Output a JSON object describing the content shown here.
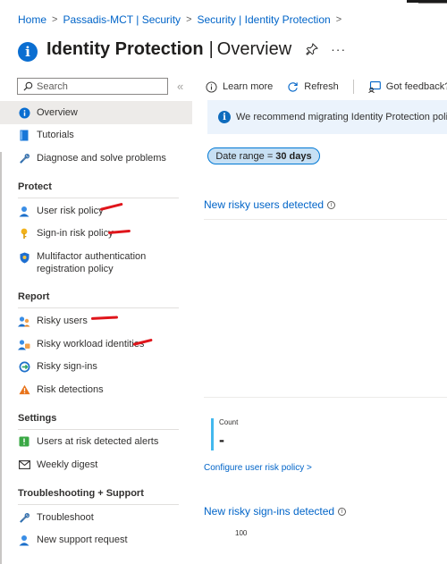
{
  "breadcrumb": [
    "Home",
    "Passadis-MCT | Security",
    "Security | Identity Protection"
  ],
  "header": {
    "title": "Identity Protection",
    "separator": "|",
    "subtitle": "Overview"
  },
  "sidebar": {
    "search_placeholder": "Search",
    "items": [
      {
        "label": "Overview",
        "icon": "info-icon",
        "active": true
      },
      {
        "label": "Tutorials",
        "icon": "book-icon"
      },
      {
        "label": "Diagnose and solve problems",
        "icon": "wrench-icon"
      }
    ],
    "sections": [
      {
        "title": "Protect",
        "items": [
          {
            "label": "User risk policy",
            "icon": "user-icon"
          },
          {
            "label": "Sign-in risk policy",
            "icon": "key-icon"
          },
          {
            "label_lines": [
              "Multifactor authentication",
              "registration policy"
            ],
            "icon": "shield-icon"
          }
        ]
      },
      {
        "title": "Report",
        "items": [
          {
            "label": "Risky users",
            "icon": "users-icon"
          },
          {
            "label": "Risky workload identities",
            "icon": "workload-icon"
          },
          {
            "label": "Risky sign-ins",
            "icon": "signin-icon"
          },
          {
            "label": "Risk detections",
            "icon": "warning-icon"
          }
        ]
      },
      {
        "title": "Settings",
        "items": [
          {
            "label": "Users at risk detected alerts",
            "icon": "alert-icon"
          },
          {
            "label": "Weekly digest",
            "icon": "mail-icon"
          }
        ]
      },
      {
        "title": "Troubleshooting + Support",
        "items": [
          {
            "label": "Troubleshoot",
            "icon": "wrench-icon"
          },
          {
            "label": "New support request",
            "icon": "support-icon"
          }
        ]
      }
    ]
  },
  "toolbar": {
    "learn_more": "Learn more",
    "refresh": "Refresh",
    "feedback": "Got feedback?"
  },
  "banner": {
    "text": "We recommend migrating Identity Protection policies"
  },
  "date_range": {
    "label": "Date range =",
    "value": "30 days"
  },
  "cards": {
    "risky_users_title": "New risky users detected",
    "count_label": "Count",
    "count_value": "-",
    "configure_link": "Configure user risk policy >",
    "risky_signins_title": "New risky sign-ins detected",
    "axis_tick": "100"
  },
  "colors": {
    "accent": "#0064c8",
    "active_bg": "#edebe9",
    "banner_bg": "#ebf3fc",
    "pill_bg": "#c7e0f4",
    "annotation": "#e0151b",
    "count_bar": "#43b8ee"
  }
}
